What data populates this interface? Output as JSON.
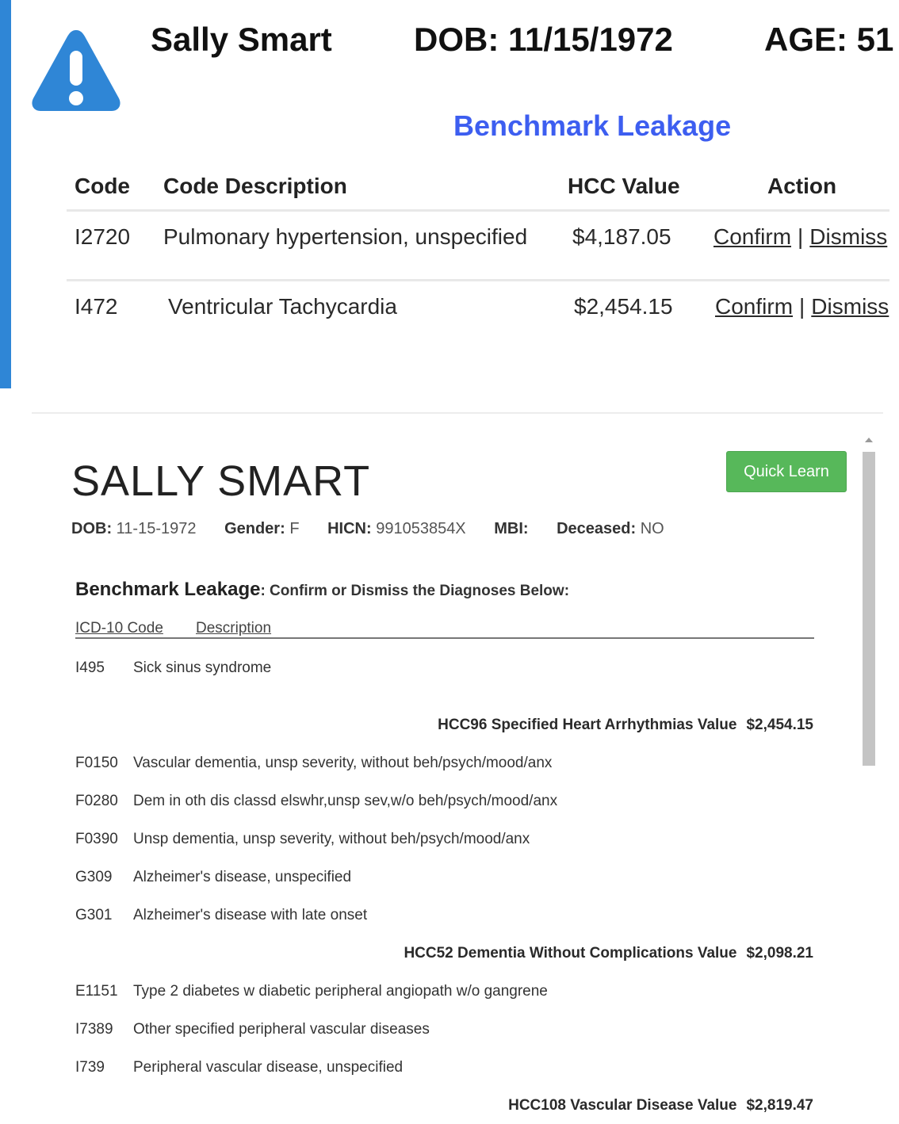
{
  "alert_header": {
    "name": "Sally Smart",
    "dob": "DOB: 11/15/1972",
    "age": "AGE: 51",
    "title": "Benchmark Leakage"
  },
  "alert_table": {
    "headers": {
      "code": "Code",
      "description": "Code Description",
      "hcc_value": "HCC Value",
      "action": "Action"
    },
    "rows": [
      {
        "code": "I2720",
        "description": "Pulmonary hypertension, unspecified",
        "value": "$4,187.05",
        "confirm": "Confirm",
        "separator": "|",
        "dismiss": "Dismiss"
      },
      {
        "code": "I472",
        "description": "Ventricular Tachycardia",
        "value": "$2,454.15",
        "confirm": "Confirm",
        "separator": "|",
        "dismiss": "Dismiss"
      }
    ]
  },
  "patient": {
    "name": "SALLY SMART",
    "quick_learn_label": "Quick Learn",
    "demographics": [
      {
        "label": "DOB:",
        "value": "11-15-1972"
      },
      {
        "label": "Gender:",
        "value": "F"
      },
      {
        "label": "HICN:",
        "value": "991053854X"
      },
      {
        "label": "MBI:",
        "value": ""
      },
      {
        "label": "Deceased:",
        "value": "NO"
      }
    ]
  },
  "benchmark": {
    "title": "Benchmark Leakage",
    "subtitle": ": Confirm or Dismiss the Diagnoses Below:",
    "col_code": "ICD-10 Code",
    "col_desc": "Description",
    "groups": [
      {
        "diagnoses": [
          {
            "code": "I495",
            "description": "Sick sinus syndrome"
          }
        ],
        "hcc_label": "HCC96 Specified Heart Arrhythmias Value",
        "hcc_value": "$2,454.15"
      },
      {
        "diagnoses": [
          {
            "code": "F0150",
            "description": "Vascular dementia, unsp severity, without beh/psych/mood/anx"
          },
          {
            "code": "F0280",
            "description": "Dem in oth dis classd elswhr,unsp sev,w/o beh/psych/mood/anx"
          },
          {
            "code": "F0390",
            "description": "Unsp dementia, unsp severity, without beh/psych/mood/anx"
          },
          {
            "code": "G309",
            "description": "Alzheimer's disease, unspecified"
          },
          {
            "code": "G301",
            "description": "Alzheimer's disease with late onset"
          }
        ],
        "hcc_label": "HCC52 Dementia Without Complications Value",
        "hcc_value": "$2,098.21"
      },
      {
        "diagnoses": [
          {
            "code": "E1151",
            "description": "Type 2 diabetes w diabetic peripheral angiopath w/o gangrene"
          },
          {
            "code": "I7389",
            "description": "Other specified peripheral vascular diseases"
          },
          {
            "code": "I739",
            "description": "Peripheral vascular disease, unspecified"
          }
        ],
        "hcc_label": "HCC108 Vascular Disease Value",
        "hcc_value": "$2,819.47"
      }
    ]
  },
  "colors": {
    "accent": "#2f86d6",
    "title_blue": "#3d5ef0",
    "link": "#3a7fd8",
    "button_green": "#57b85a"
  }
}
